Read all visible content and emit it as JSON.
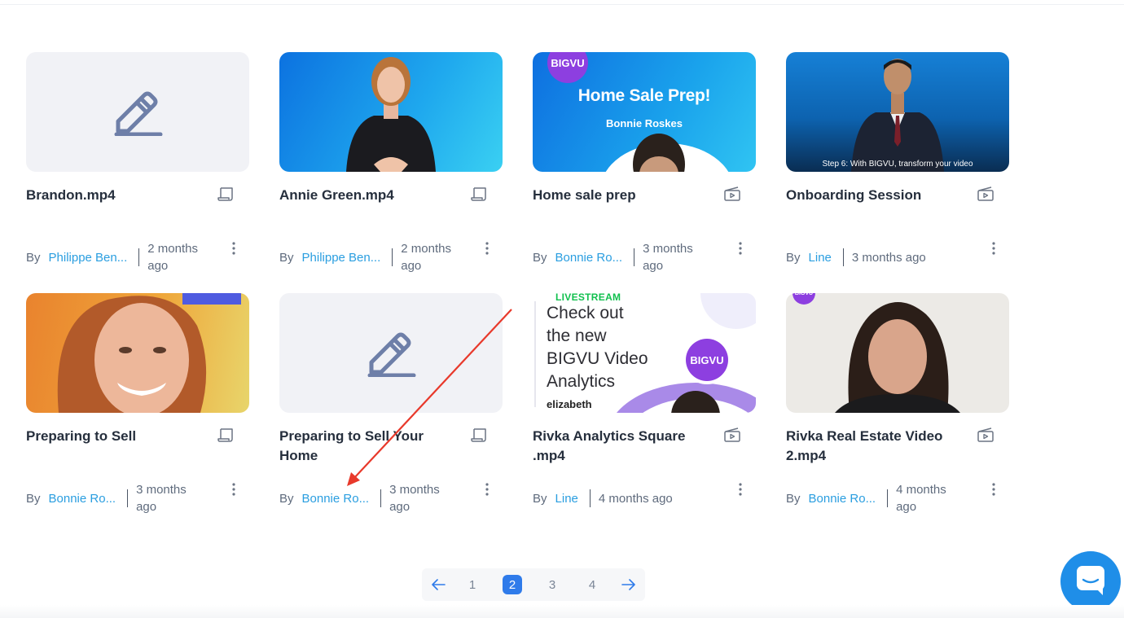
{
  "cards": [
    {
      "title": "Brandon.mp4",
      "by": "By",
      "author": "Philippe Ben...",
      "ago": "2 months ago",
      "thumbnail": "pencil-placeholder",
      "type_icon": "script-icon"
    },
    {
      "title": "Annie Green.mp4",
      "by": "By",
      "author": "Philippe Ben...",
      "ago": "2 months ago",
      "thumbnail": "presenter-woman-blue-background",
      "type_icon": "script-icon"
    },
    {
      "title": "Home sale prep",
      "by": "By",
      "author": "Bonnie Ro...",
      "ago": "3 months ago",
      "thumbnail": "home-sale-prep-title-card",
      "thumb_text": {
        "logo": "BIGVU",
        "headline": "Home Sale Prep!",
        "subline": "Bonnie Roskes"
      },
      "type_icon": "video-icon"
    },
    {
      "title": "Onboarding Session",
      "by": "By",
      "author": "Line",
      "ago": "3 months ago",
      "thumbnail": "presenter-man-suit",
      "thumb_text": {
        "caption": "Step 6: With BIGVU, transform your video"
      },
      "type_icon": "video-icon"
    },
    {
      "title": "Preparing to Sell",
      "by": "By",
      "author": "Bonnie Ro...",
      "ago": "3 months ago",
      "thumbnail": "woman-closeup-orange",
      "type_icon": "script-icon"
    },
    {
      "title": "Preparing to Sell Your Home",
      "by": "By",
      "author": "Bonnie Ro...",
      "ago": "3 months ago",
      "thumbnail": "pencil-placeholder",
      "type_icon": "script-icon"
    },
    {
      "title": "Rivka Analytics Square .mp4",
      "by": "By",
      "author": "Line",
      "ago": "4 months ago",
      "thumbnail": "livestream-analytics",
      "thumb_text": {
        "tag": "LIVESTREAM",
        "lines": [
          "Check out",
          "the new",
          "BIGVU Video",
          "Analytics"
        ],
        "name": "elizabeth",
        "logo": "BIGVU"
      },
      "type_icon": "video-icon"
    },
    {
      "title": "Rivka Real Estate Video 2.mp4",
      "by": "By",
      "author": "Bonnie Ro...",
      "ago": "4 months ago",
      "thumbnail": "woman-presenter-light",
      "thumb_text": {
        "logo": "BIGVU"
      },
      "type_icon": "video-icon"
    }
  ],
  "pagination": {
    "prev_icon": "arrow-left-icon",
    "next_icon": "arrow-right-icon",
    "pages": [
      "1",
      "2",
      "3",
      "4"
    ],
    "current": "2"
  },
  "chat": {
    "icon": "chat-bubble-icon"
  },
  "colors": {
    "link": "#2a9ee0",
    "active_page": "#2f7bea",
    "chat_button": "#1f8ee8",
    "annotation_arrow": "#e8392b"
  }
}
